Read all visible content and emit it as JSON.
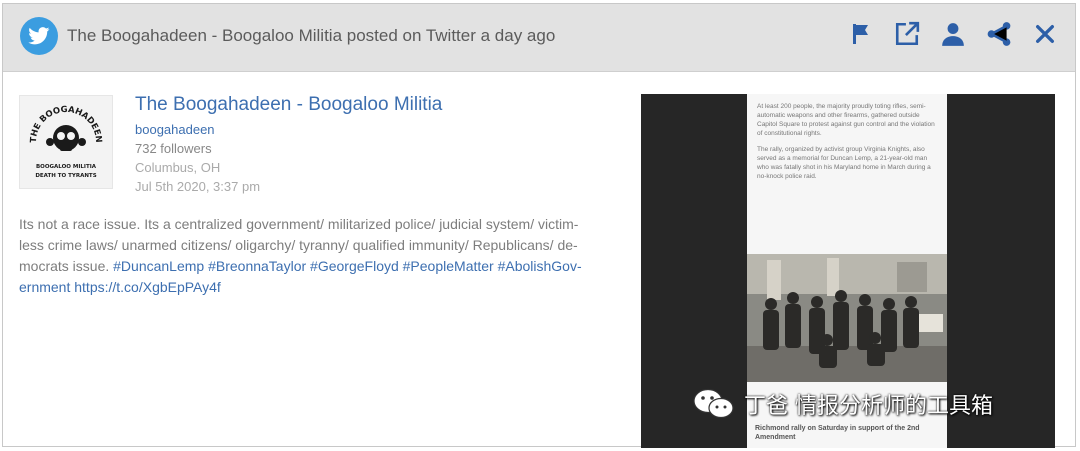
{
  "header": {
    "title": "The Boogahadeen - Boogaloo Militia posted on Twitter a day ago",
    "platform_icon": "twitter-bird-icon",
    "accent": "#3b9de0",
    "actions": [
      "flag-icon",
      "external-link-icon",
      "user-icon",
      "share-icon",
      "close-icon"
    ],
    "icon_color": "#2d5fa8"
  },
  "profile": {
    "name": "The Boogahadeen - Boogaloo Militia",
    "handle": "boogahadeen",
    "followers": "732 followers",
    "location": "Columbus, OH",
    "date": "Jul 5th 2020, 3:37 pm",
    "avatar": {
      "top_text": "THE BOOGAHADEEN",
      "line1": "BOOGALOO MILITIA",
      "line2": "DEATH TO TYRANTS"
    }
  },
  "post": {
    "text": "Its not a race issue. Its a centralized government/ militarized police/ judicial system/ victim-less crime laws/ unarmed citizens/ oligarchy/ tyranny/ qualified immunity/ Republicans/ de-mocrats issue. ",
    "hashtags": "#DuncanLemp #BreonnaTaylor #GeorgeFloyd #PeopleMatter #AbolishGov-ernment",
    "link": "https://t.co/XgbEpPAy4f"
  },
  "media": {
    "paragraph1": "At least 200 people, the majority proudly toting rifles, semi-automatic weapons and other firearms, gathered outside Capitol Square to protest against gun control and the violation of constitutional rights.",
    "paragraph2": "The rally, organized by activist group Virginia Knights, also served as a memorial for Duncan Lemp, a 21-year-old man who was fatally shot in his Maryland home in March during a no-knock police raid.",
    "caption": "Richmond rally on Saturday in support of the 2nd Amendment"
  },
  "watermark": {
    "text": "丁爸 情报分析师的工具箱"
  }
}
